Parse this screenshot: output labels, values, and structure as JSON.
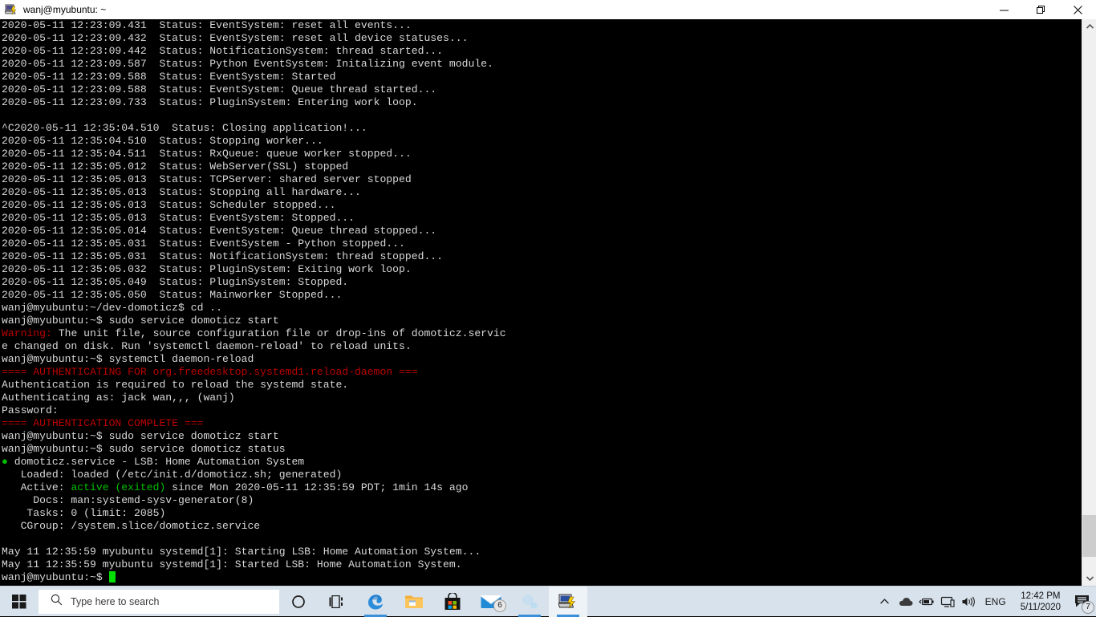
{
  "window": {
    "title": "wanj@myubuntu: ~",
    "icon": "putty-icon",
    "buttons": {
      "minimize": "minimize-button",
      "maximize": "restore-button",
      "close": "close-button"
    }
  },
  "terminal": {
    "background": "#000000",
    "foreground": "#d8d8d8",
    "cursor_color": "#00e000",
    "lines": [
      {
        "segments": [
          {
            "text": "2020-05-11 12:23:09.431  Status: EventSystem: reset all events...",
            "color": "default"
          }
        ]
      },
      {
        "segments": [
          {
            "text": "2020-05-11 12:23:09.432  Status: EventSystem: reset all device statuses...",
            "color": "default"
          }
        ]
      },
      {
        "segments": [
          {
            "text": "2020-05-11 12:23:09.442  Status: NotificationSystem: thread started...",
            "color": "default"
          }
        ]
      },
      {
        "segments": [
          {
            "text": "2020-05-11 12:23:09.587  Status: Python EventSystem: Initalizing event module.",
            "color": "default"
          }
        ]
      },
      {
        "segments": [
          {
            "text": "2020-05-11 12:23:09.588  Status: EventSystem: Started",
            "color": "default"
          }
        ]
      },
      {
        "segments": [
          {
            "text": "2020-05-11 12:23:09.588  Status: EventSystem: Queue thread started...",
            "color": "default"
          }
        ]
      },
      {
        "segments": [
          {
            "text": "2020-05-11 12:23:09.733  Status: PluginSystem: Entering work loop.",
            "color": "default"
          }
        ]
      },
      {
        "segments": [
          {
            "text": "",
            "color": "default"
          }
        ]
      },
      {
        "segments": [
          {
            "text": "^C2020-05-11 12:35:04.510  Status: Closing application!...",
            "color": "default"
          }
        ]
      },
      {
        "segments": [
          {
            "text": "2020-05-11 12:35:04.510  Status: Stopping worker...",
            "color": "default"
          }
        ]
      },
      {
        "segments": [
          {
            "text": "2020-05-11 12:35:04.511  Status: RxQueue: queue worker stopped...",
            "color": "default"
          }
        ]
      },
      {
        "segments": [
          {
            "text": "2020-05-11 12:35:05.012  Status: WebServer(SSL) stopped",
            "color": "default"
          }
        ]
      },
      {
        "segments": [
          {
            "text": "2020-05-11 12:35:05.013  Status: TCPServer: shared server stopped",
            "color": "default"
          }
        ]
      },
      {
        "segments": [
          {
            "text": "2020-05-11 12:35:05.013  Status: Stopping all hardware...",
            "color": "default"
          }
        ]
      },
      {
        "segments": [
          {
            "text": "2020-05-11 12:35:05.013  Status: Scheduler stopped...",
            "color": "default"
          }
        ]
      },
      {
        "segments": [
          {
            "text": "2020-05-11 12:35:05.013  Status: EventSystem: Stopped...",
            "color": "default"
          }
        ]
      },
      {
        "segments": [
          {
            "text": "2020-05-11 12:35:05.014  Status: EventSystem: Queue thread stopped...",
            "color": "default"
          }
        ]
      },
      {
        "segments": [
          {
            "text": "2020-05-11 12:35:05.031  Status: EventSystem - Python stopped...",
            "color": "default"
          }
        ]
      },
      {
        "segments": [
          {
            "text": "2020-05-11 12:35:05.031  Status: NotificationSystem: thread stopped...",
            "color": "default"
          }
        ]
      },
      {
        "segments": [
          {
            "text": "2020-05-11 12:35:05.032  Status: PluginSystem: Exiting work loop.",
            "color": "default"
          }
        ]
      },
      {
        "segments": [
          {
            "text": "2020-05-11 12:35:05.049  Status: PluginSystem: Stopped.",
            "color": "default"
          }
        ]
      },
      {
        "segments": [
          {
            "text": "2020-05-11 12:35:05.050  Status: Mainworker Stopped...",
            "color": "default"
          }
        ]
      },
      {
        "segments": [
          {
            "text": "wanj@myubuntu:~/dev-domoticz$ cd ..",
            "color": "default"
          }
        ]
      },
      {
        "segments": [
          {
            "text": "wanj@myubuntu:~$ sudo service domoticz start",
            "color": "default"
          }
        ]
      },
      {
        "segments": [
          {
            "text": "Warning:",
            "color": "red"
          },
          {
            "text": " The unit file, source configuration file or drop-ins of domoticz.servic",
            "color": "default"
          }
        ]
      },
      {
        "segments": [
          {
            "text": "e changed on disk. Run 'systemctl daemon-reload' to reload units.",
            "color": "default"
          }
        ]
      },
      {
        "segments": [
          {
            "text": "wanj@myubuntu:~$ systemctl daemon-reload",
            "color": "default"
          }
        ]
      },
      {
        "segments": [
          {
            "text": "==== AUTHENTICATING FOR org.freedesktop.systemd1.reload-daemon ===",
            "color": "red"
          }
        ]
      },
      {
        "segments": [
          {
            "text": "Authentication is required to reload the systemd state.",
            "color": "default"
          }
        ]
      },
      {
        "segments": [
          {
            "text": "Authenticating as: jack wan,,, (wanj)",
            "color": "default"
          }
        ]
      },
      {
        "segments": [
          {
            "text": "Password:",
            "color": "default"
          }
        ]
      },
      {
        "segments": [
          {
            "text": "==== AUTHENTICATION COMPLETE ===",
            "color": "red"
          }
        ]
      },
      {
        "segments": [
          {
            "text": "wanj@myubuntu:~$ sudo service domoticz start",
            "color": "default"
          }
        ]
      },
      {
        "segments": [
          {
            "text": "wanj@myubuntu:~$ sudo service domoticz status",
            "color": "default"
          }
        ]
      },
      {
        "segments": [
          {
            "text": "●",
            "color": "green"
          },
          {
            "text": " domoticz.service - LSB: Home Automation System",
            "color": "default"
          }
        ]
      },
      {
        "segments": [
          {
            "text": "   Loaded: loaded (/etc/init.d/domoticz.sh; generated)",
            "color": "default"
          }
        ]
      },
      {
        "segments": [
          {
            "text": "   Active: ",
            "color": "default"
          },
          {
            "text": "active (exited)",
            "color": "green"
          },
          {
            "text": " since Mon 2020-05-11 12:35:59 PDT; 1min 14s ago",
            "color": "default"
          }
        ]
      },
      {
        "segments": [
          {
            "text": "     Docs: man:systemd-sysv-generator(8)",
            "color": "default"
          }
        ]
      },
      {
        "segments": [
          {
            "text": "    Tasks: 0 (limit: 2085)",
            "color": "default"
          }
        ]
      },
      {
        "segments": [
          {
            "text": "   CGroup: /system.slice/domoticz.service",
            "color": "default"
          }
        ]
      },
      {
        "segments": [
          {
            "text": "",
            "color": "default"
          }
        ]
      },
      {
        "segments": [
          {
            "text": "May 11 12:35:59 myubuntu systemd[1]: Starting LSB: Home Automation System...",
            "color": "default"
          }
        ]
      },
      {
        "segments": [
          {
            "text": "May 11 12:35:59 myubuntu systemd[1]: Started LSB: Home Automation System.",
            "color": "default"
          }
        ]
      },
      {
        "segments": [
          {
            "text": "wanj@myubuntu:~$ ",
            "color": "default"
          },
          {
            "text": "",
            "cursor": true
          }
        ]
      }
    ]
  },
  "scrollbar": {
    "up_arrow": "scroll-up-arrow",
    "down_arrow": "scroll-down-arrow",
    "thumb_position": "bottom"
  },
  "taskbar": {
    "start": "windows-start-icon",
    "search": {
      "placeholder": "Type here to search",
      "icon": "search-icon"
    },
    "apps": [
      {
        "name": "cortana-icon",
        "label": "Cortana",
        "active": false,
        "running": false
      },
      {
        "name": "task-view-icon",
        "label": "Task View",
        "active": false,
        "running": false
      },
      {
        "name": "edge-icon",
        "label": "Microsoft Edge",
        "active": false,
        "running": true
      },
      {
        "name": "file-explorer-icon",
        "label": "File Explorer",
        "active": false,
        "running": false
      },
      {
        "name": "microsoft-store-icon",
        "label": "Microsoft Store",
        "active": false,
        "running": false
      },
      {
        "name": "mail-icon",
        "label": "Mail",
        "active": false,
        "running": false,
        "badge": "6"
      },
      {
        "name": "settings-sync-icon",
        "label": "Settings",
        "active": false,
        "running": true
      },
      {
        "name": "putty-icon",
        "label": "PuTTY",
        "active": true,
        "running": true
      }
    ],
    "tray": {
      "show_hidden": "chevron-up-icon",
      "onedrive": "onedrive-cloud-icon",
      "battery": "battery-icon",
      "network": "network-icon",
      "volume": "volume-icon",
      "language": "ENG",
      "time": "12:42 PM",
      "date": "5/11/2020",
      "action_center": "action-center-icon",
      "action_center_badge": "7"
    }
  }
}
